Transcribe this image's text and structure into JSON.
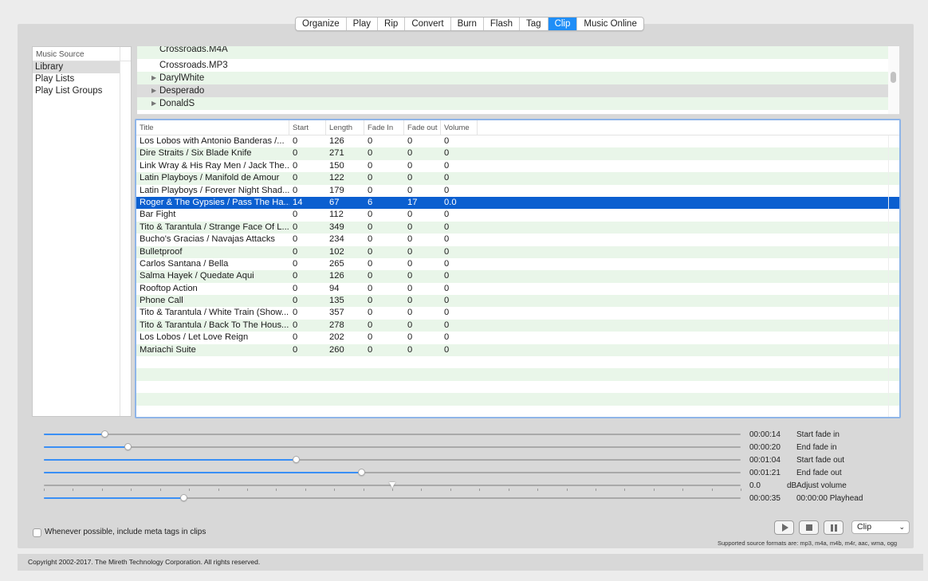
{
  "tabs": [
    {
      "label": "Organize",
      "active": false
    },
    {
      "label": "Play",
      "active": false
    },
    {
      "label": "Rip",
      "active": false
    },
    {
      "label": "Convert",
      "active": false
    },
    {
      "label": "Burn",
      "active": false
    },
    {
      "label": "Flash",
      "active": false
    },
    {
      "label": "Tag",
      "active": false
    },
    {
      "label": "Clip",
      "active": true
    },
    {
      "label": "Music Online",
      "active": false
    }
  ],
  "sidebar": {
    "header": "Music Source",
    "items": [
      {
        "label": "Library",
        "selected": true
      },
      {
        "label": "Play Lists",
        "selected": false
      },
      {
        "label": "Play List Groups",
        "selected": false
      }
    ]
  },
  "tree": {
    "rows": [
      {
        "label": "Crossroads.M4A",
        "folder": false
      },
      {
        "label": "Crossroads.MP3",
        "folder": false
      },
      {
        "label": "DarylWhite",
        "folder": true
      },
      {
        "label": "Desperado",
        "folder": true,
        "selected": true
      },
      {
        "label": "DonaldS",
        "folder": true
      }
    ]
  },
  "table": {
    "columns": [
      "Title",
      "Start",
      "Length",
      "Fade In",
      "Fade out",
      "Volume"
    ],
    "selected_index": 5,
    "rows": [
      [
        "Los Lobos with Antonio Banderas /...",
        "0",
        "126",
        "0",
        "0",
        "0"
      ],
      [
        "Dire Straits / Six Blade Knife",
        "0",
        "271",
        "0",
        "0",
        "0"
      ],
      [
        "Link Wray & His Ray Men / Jack The...",
        "0",
        "150",
        "0",
        "0",
        "0"
      ],
      [
        "Latin Playboys / Manifold de Amour",
        "0",
        "122",
        "0",
        "0",
        "0"
      ],
      [
        "Latin Playboys / Forever Night Shad...",
        "0",
        "179",
        "0",
        "0",
        "0"
      ],
      [
        "Roger & The Gypsies / Pass The Ha...",
        "14",
        "67",
        "6",
        "17",
        "0.0"
      ],
      [
        "Bar Fight",
        "0",
        "112",
        "0",
        "0",
        "0"
      ],
      [
        "Tito & Tarantula / Strange Face Of L...",
        "0",
        "349",
        "0",
        "0",
        "0"
      ],
      [
        "Bucho's Gracias / Navajas Attacks",
        "0",
        "234",
        "0",
        "0",
        "0"
      ],
      [
        "Bulletproof",
        "0",
        "102",
        "0",
        "0",
        "0"
      ],
      [
        "Carlos Santana / Bella",
        "0",
        "265",
        "0",
        "0",
        "0"
      ],
      [
        "Salma Hayek / Quedate Aqui",
        "0",
        "126",
        "0",
        "0",
        "0"
      ],
      [
        "Rooftop Action",
        "0",
        "94",
        "0",
        "0",
        "0"
      ],
      [
        "Phone Call",
        "0",
        "135",
        "0",
        "0",
        "0"
      ],
      [
        "Tito & Tarantula / White Train (Show...",
        "0",
        "357",
        "0",
        "0",
        "0"
      ],
      [
        "Tito & Tarantula / Back To The Hous...",
        "0",
        "278",
        "0",
        "0",
        "0"
      ],
      [
        "Los Lobos / Let Love Reign",
        "0",
        "202",
        "0",
        "0",
        "0"
      ],
      [
        "Mariachi Suite",
        "0",
        "260",
        "0",
        "0",
        "0"
      ]
    ],
    "empty_rows": 4
  },
  "sliders": [
    {
      "name": "start-fade-in",
      "value": "00:00:14",
      "label": "Start fade in",
      "level": 0.087
    },
    {
      "name": "end-fade-in",
      "value": "00:00:20",
      "label": "End fade in",
      "level": 0.12
    },
    {
      "name": "start-fade-out",
      "value": "00:01:04",
      "label": "Start fade out",
      "level": 0.362
    },
    {
      "name": "end-fade-out",
      "value": "00:01:21",
      "label": "End fade out",
      "level": 0.455
    },
    {
      "name": "adjust-volume",
      "value": "0.0",
      "unit": "dB",
      "label": "Adjust volume",
      "level": 0.5,
      "ticked": true
    },
    {
      "name": "playhead",
      "value": "00:00:35",
      "label": "00:00:00  Playhead",
      "level": 0.2
    }
  ],
  "controls": {
    "meta_label": "Whenever possible, include meta tags in clips",
    "meta_checked": false,
    "mode": "Clip",
    "formats": "Supported source formats are: mp3, m4a, m4b, m4r, aac, wma, ogg"
  },
  "footer": "Copyright 2002-2017.  The Mireth Technology Corporation. All rights reserved.",
  "colors": {
    "accent": "#1f8ef7",
    "selection": "#0b5fd0",
    "row_alt": "#e9f6e9",
    "slider_fill": "#3a8ff5"
  }
}
